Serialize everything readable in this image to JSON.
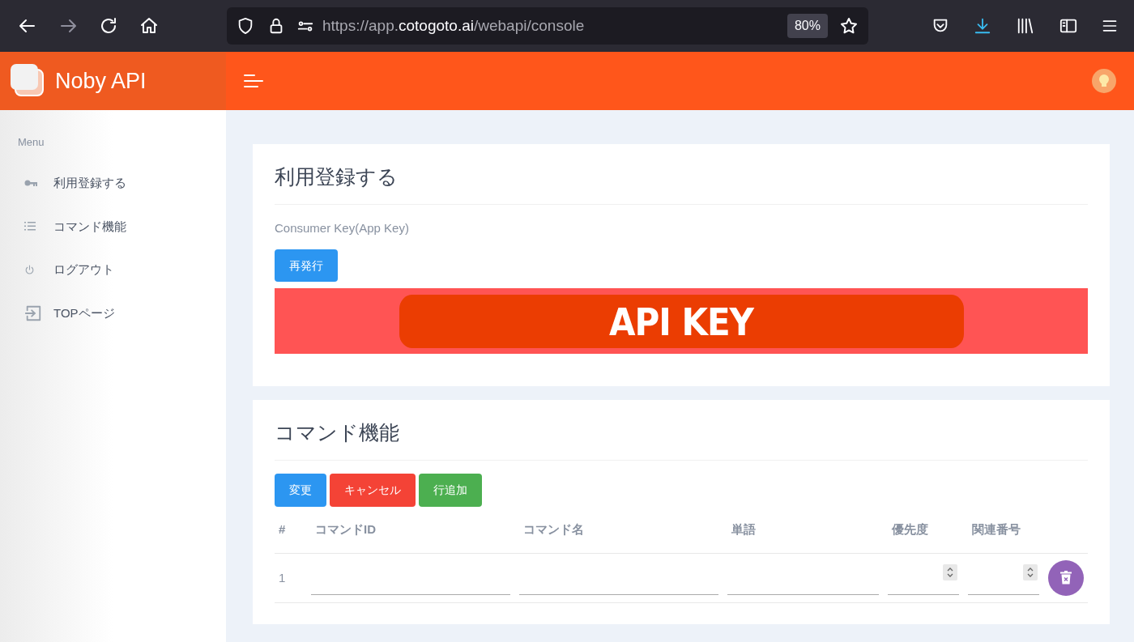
{
  "browser": {
    "url_prefix": "https://app.",
    "url_domain": "cotogoto.ai",
    "url_path": "/webapi/console",
    "zoom": "80%"
  },
  "app": {
    "title": "Noby API"
  },
  "sidebar": {
    "heading": "Menu",
    "items": [
      {
        "label": "利用登録する",
        "kind": "key"
      },
      {
        "label": "コマンド機能",
        "kind": "list"
      },
      {
        "label": "ログアウト",
        "kind": "power"
      },
      {
        "label": "TOPページ",
        "kind": "enter"
      }
    ]
  },
  "registration": {
    "title": "利用登録する",
    "key_label": "Consumer Key(App Key)",
    "reissue_button": "再発行",
    "api_key": "API KEY"
  },
  "commands": {
    "title": "コマンド機能",
    "buttons": [
      {
        "label": "変更",
        "kind": "primary"
      },
      {
        "label": "キャンセル",
        "kind": "danger"
      },
      {
        "label": "行追加",
        "kind": "success"
      }
    ],
    "columns": [
      "#",
      "コマンドID",
      "コマンド名",
      "単語",
      "優先度",
      "関連番号"
    ],
    "rows": [
      {
        "number": "1"
      }
    ]
  }
}
